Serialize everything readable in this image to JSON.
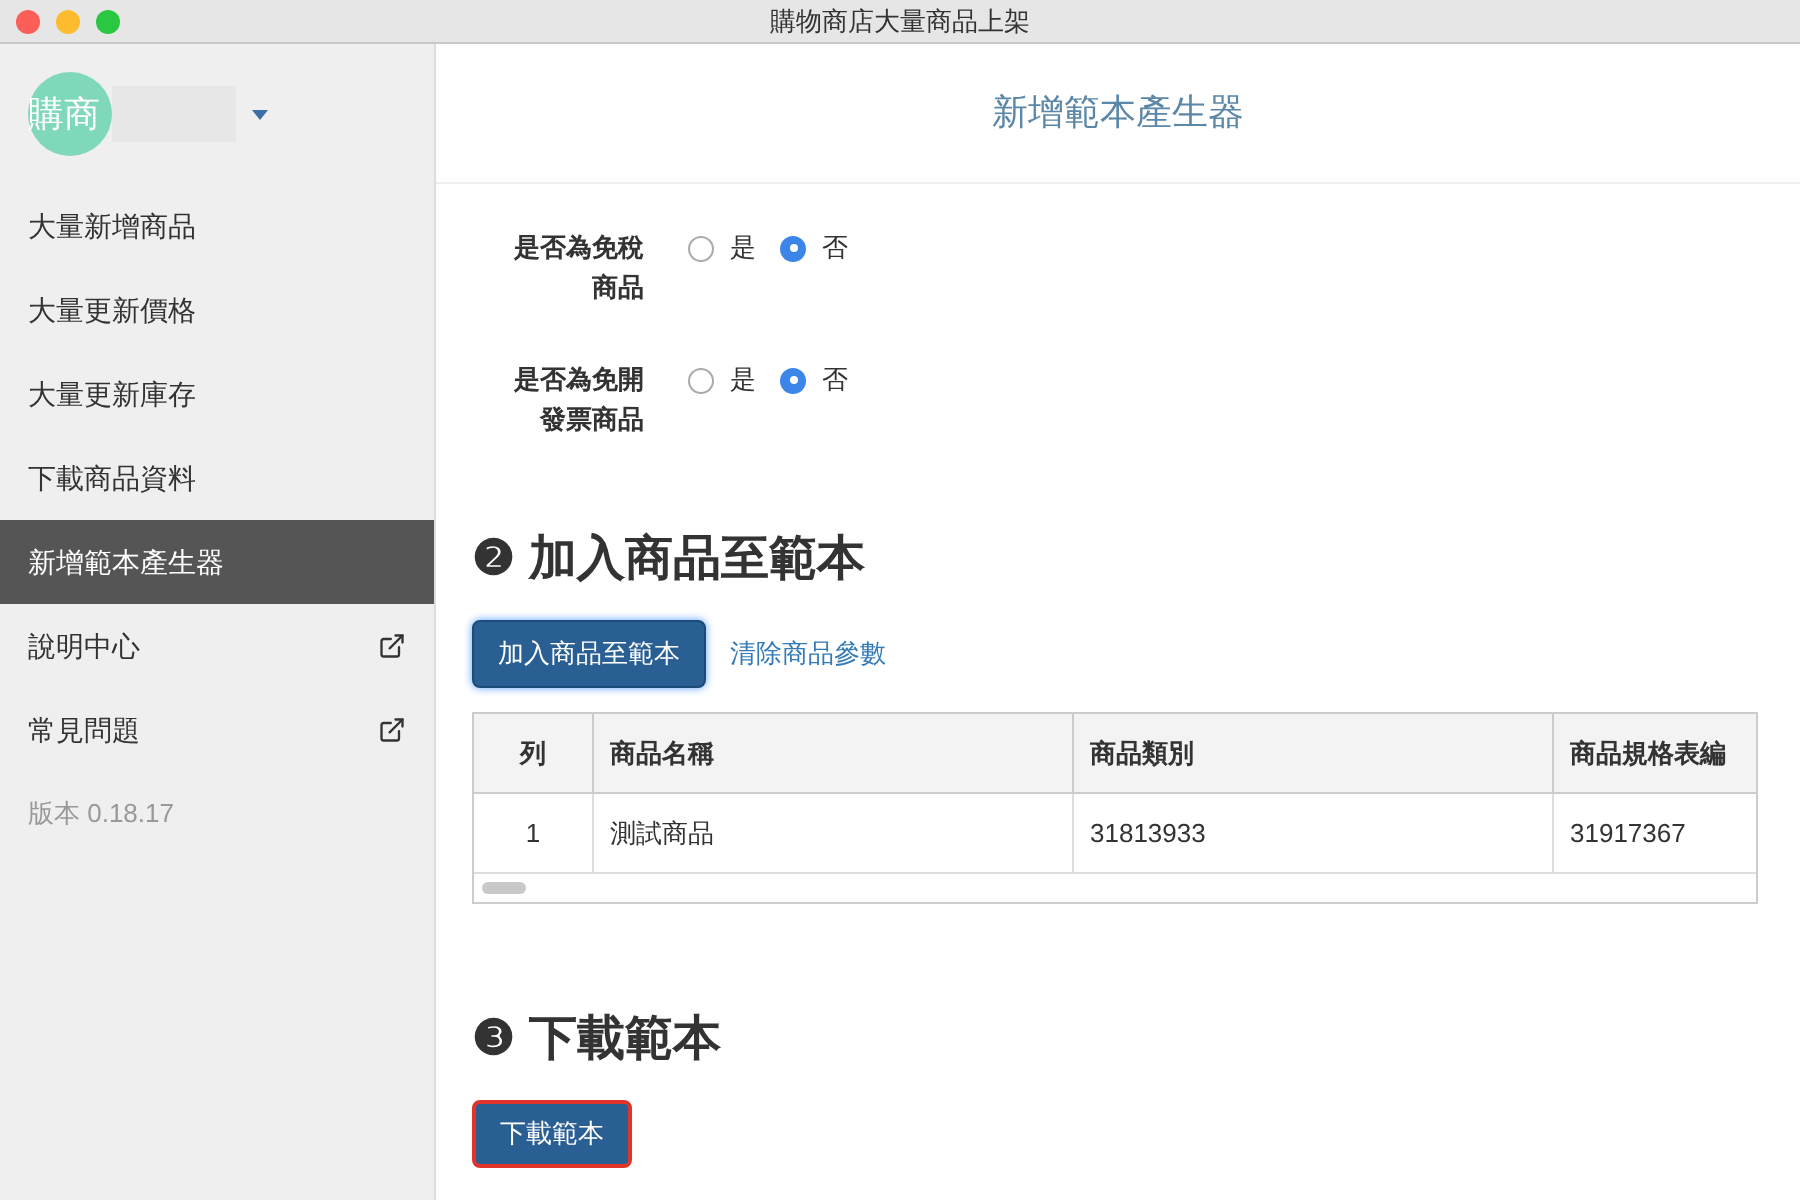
{
  "window": {
    "title": "購物商店大量商品上架"
  },
  "account": {
    "avatar": "購商"
  },
  "sidebar": {
    "items": [
      {
        "label": "大量新增商品",
        "selected": false,
        "external": false
      },
      {
        "label": "大量更新價格",
        "selected": false,
        "external": false
      },
      {
        "label": "大量更新庫存",
        "selected": false,
        "external": false
      },
      {
        "label": "下載商品資料",
        "selected": false,
        "external": false
      },
      {
        "label": "新增範本產生器",
        "selected": true,
        "external": false
      },
      {
        "label": "說明中心",
        "selected": false,
        "external": true
      },
      {
        "label": "常見問題",
        "selected": false,
        "external": true
      }
    ],
    "version": "版本 0.18.17"
  },
  "page_title": "新增範本產生器",
  "questions": [
    {
      "label": "是否為免稅商品",
      "options": [
        {
          "label": "是",
          "selected": false
        },
        {
          "label": "否",
          "selected": true
        }
      ]
    },
    {
      "label": "是否為免開發票商品",
      "options": [
        {
          "label": "是",
          "selected": false
        },
        {
          "label": "否",
          "selected": true
        }
      ]
    }
  ],
  "section_add": {
    "heading": "❷ 加入商品至範本",
    "add_button": "加入商品至範本",
    "clear_link": "清除商品參數"
  },
  "table": {
    "columns": [
      "列",
      "商品名稱",
      "商品類別",
      "商品規格表編"
    ],
    "rows": [
      [
        "1",
        "測試商品",
        "31813933",
        "31917367"
      ]
    ]
  },
  "section_download": {
    "heading": "❸ 下載範本",
    "download_button": "下載範本"
  }
}
